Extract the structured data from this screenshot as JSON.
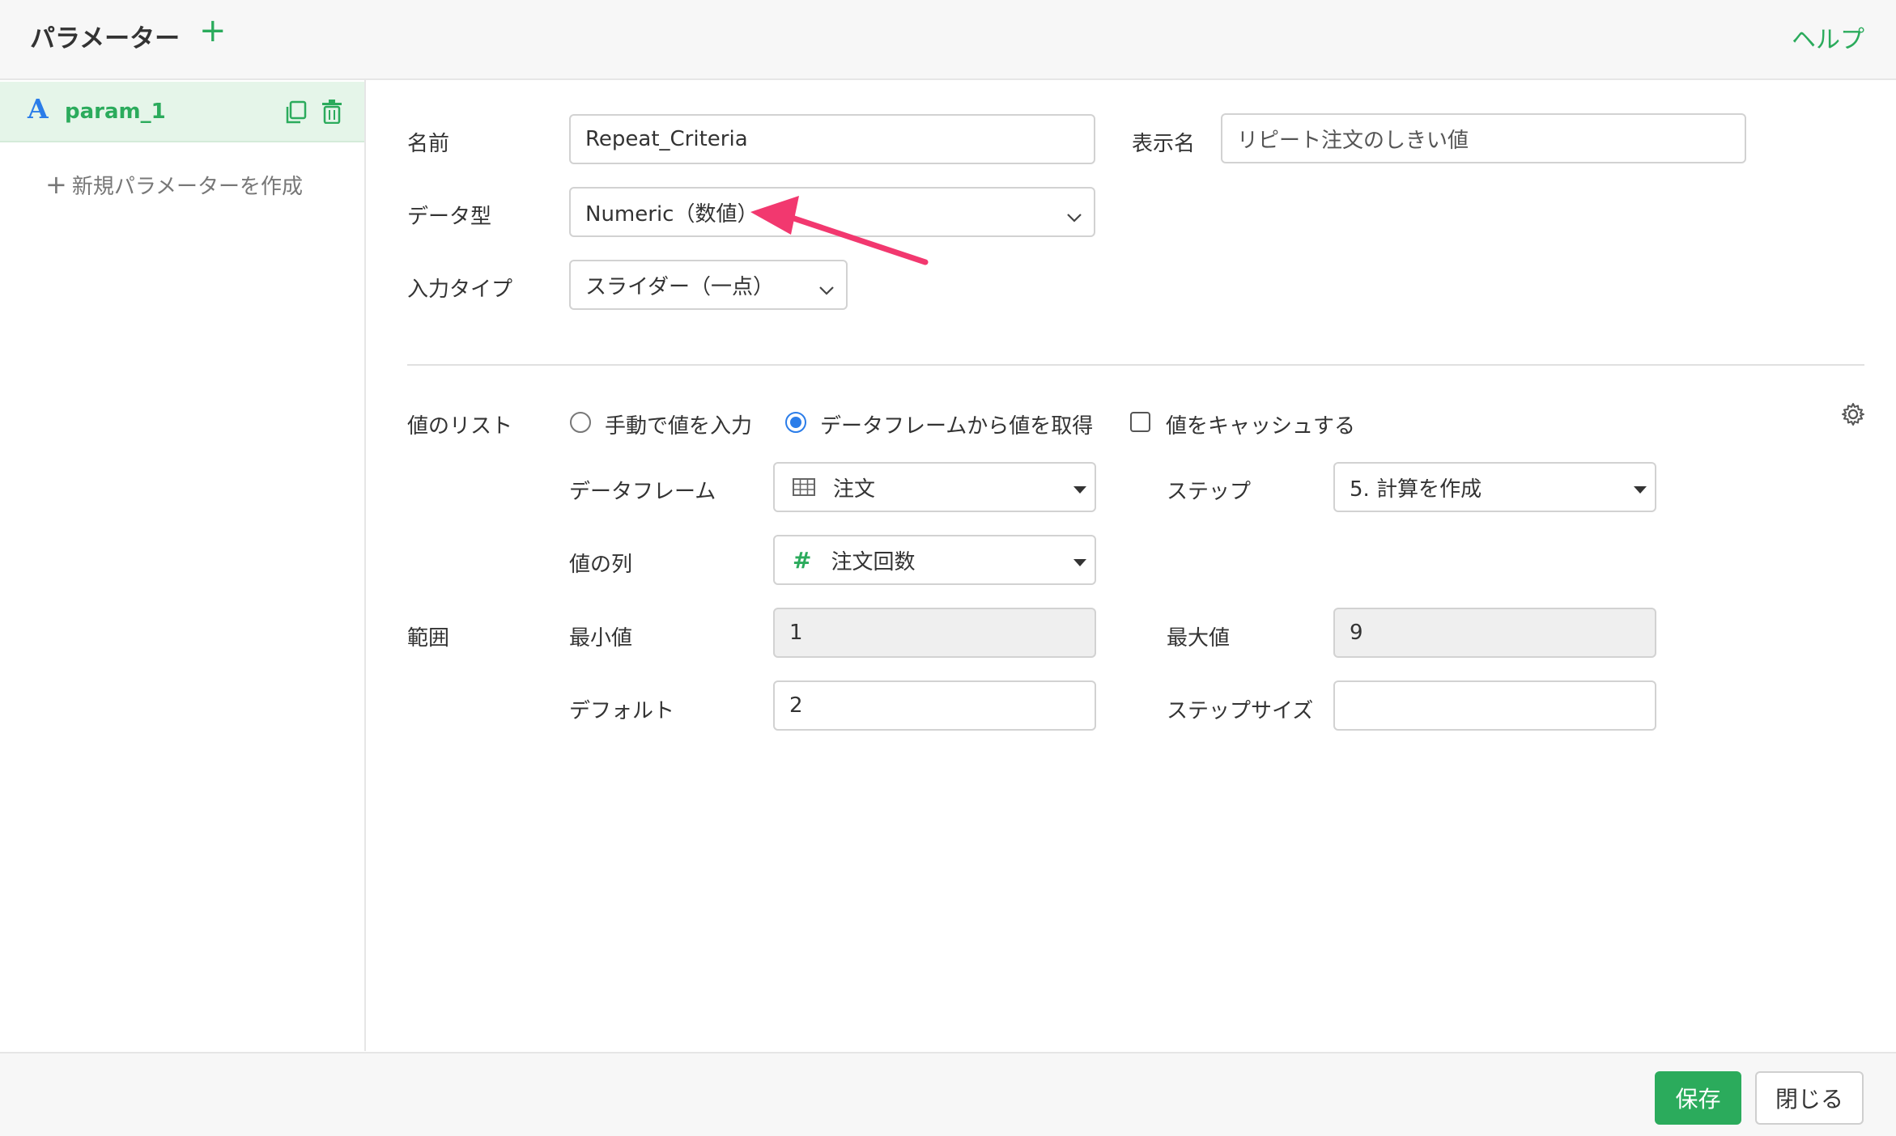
{
  "header": {
    "title": "パラメーター",
    "add_label": "+",
    "help_label": "ヘルプ"
  },
  "sidebar": {
    "param": {
      "type_icon": "A",
      "name": "param_1"
    },
    "new_param_label": "新規パラメーターを作成"
  },
  "form": {
    "name_label": "名前",
    "name_value": "Repeat_Criteria",
    "display_name_label": "表示名",
    "display_name_value": "リピート注文のしきい値",
    "data_type_label": "データ型",
    "data_type_value": "Numeric（数値）",
    "input_type_label": "入力タイプ",
    "input_type_value": "スライダー（一点）"
  },
  "values": {
    "list_label": "値のリスト",
    "manual_option": "手動で値を入力",
    "dataframe_option": "データフレームから値を取得",
    "cache_option": "値をキャッシュする",
    "selected_source": "dataframe",
    "cache_checked": false,
    "dataframe_label": "データフレーム",
    "dataframe_value": "注文",
    "step_label": "ステップ",
    "step_value": "5. 計算を作成",
    "column_label": "値の列",
    "column_value": "注文回数",
    "range_label": "範囲",
    "min_label": "最小値",
    "min_value": "1",
    "max_label": "最大値",
    "max_value": "9",
    "default_label": "デフォルト",
    "default_value": "2",
    "step_size_label": "ステップサイズ",
    "step_size_value": ""
  },
  "footer": {
    "save_label": "保存",
    "close_label": "閉じる"
  },
  "colors": {
    "accent": "#2bab5c",
    "selected_bg": "#e5f5e9",
    "radio_blue": "#2b7de9",
    "annotation_arrow": "#f2386f"
  },
  "icons": {
    "copy": "copy-icon",
    "delete": "trash-icon",
    "table": "table-icon",
    "number": "hash-icon",
    "settings": "gear-icon"
  }
}
